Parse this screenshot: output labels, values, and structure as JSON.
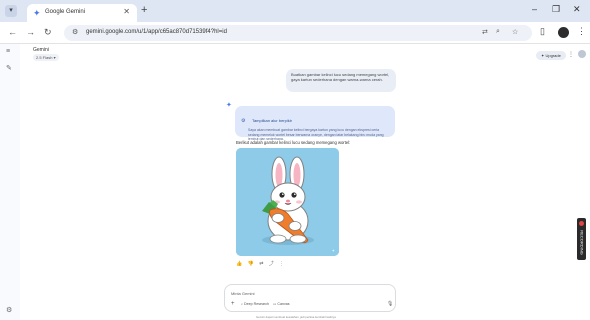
{
  "browser": {
    "tab_title": "Google Gemini",
    "url": "gemini.google.com/u/1/app/c65ac870d71539f4?hl=id"
  },
  "icons": {
    "tab_menu": "▾",
    "favicon": "✦",
    "close": "✕",
    "new_tab": "+",
    "minimize": "–",
    "restore": "❐",
    "win_close": "✕",
    "back": "←",
    "forward": "→",
    "reload": "↻",
    "site_info": "⚙",
    "translate": "⇄",
    "zoom": "⌕",
    "bookmark": "☆",
    "side_panel": "▯",
    "menu": "⋮",
    "rail_menu": "≡",
    "rail_new": "✎",
    "rail_settings": "⚙",
    "gem": "✦",
    "thought": "⚙",
    "plus": "+",
    "mic": "🎙"
  },
  "app": {
    "name": "Gemini",
    "model": "2.5 Flash ▾",
    "upgrade_label": "✦ Upgrade",
    "share_icon": "⋮"
  },
  "chat": {
    "user_message": "Buatkan gambar kelinci lucu sedang memegang wortel, gaya kartun sederhana dengan warna-warna cerah.",
    "thought_title": "Tampilkan alur berpikir",
    "thought_body": "Saya akan membuat gambar kelinci bergaya kartun yang lucu dengan ekspresi ceria sedang memeluk wortel besar berwarna oranye, dengan latar belakang biru muda yang lembut dan sederhana.",
    "reply": "Berikut adalah gambar kelinci lucu sedang memegang wortel:",
    "actions": "👍 👎 ⇄ ⤴ ⋮",
    "image_watermark": "✦"
  },
  "composer": {
    "placeholder": "Minta Gemini",
    "deep_research": "Deep Research",
    "canvas": "Canvas"
  },
  "disclaimer": "Gemini dapat membuat kesalahan, jadi periksa kembali hasilnya",
  "extension": {
    "label": "RECORDING"
  },
  "colors": {
    "accent": "#4a78e8",
    "bubble": "#e9eef6",
    "thought": "#dfe8fb",
    "image_bg": "#8dcbe8",
    "carrot": "#ef7d2c"
  }
}
